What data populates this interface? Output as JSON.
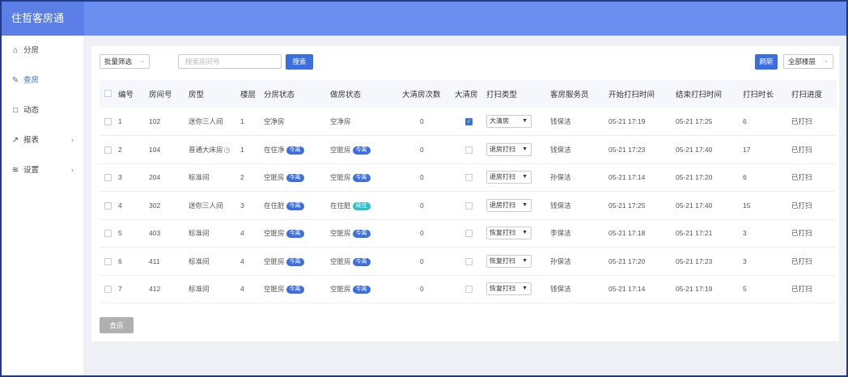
{
  "app": {
    "title": "住哲客房通"
  },
  "sidebar": {
    "items": [
      {
        "label": "分房",
        "icon": "home-icon",
        "chevron": false,
        "active": false
      },
      {
        "label": "查房",
        "icon": "edit-icon",
        "chevron": false,
        "active": true
      },
      {
        "label": "动态",
        "icon": "notification-icon",
        "chevron": false,
        "active": false
      },
      {
        "label": "报表",
        "icon": "chart-icon",
        "chevron": true,
        "active": false
      },
      {
        "label": "设置",
        "icon": "layers-icon",
        "chevron": true,
        "active": false
      }
    ]
  },
  "toolbar": {
    "batch_filter": "批量筛选",
    "search_placeholder": "搜索房间号",
    "search_label": "搜索",
    "refresh_label": "刷新",
    "floor_select": "全部楼层"
  },
  "table": {
    "headers": [
      "编号",
      "房间号",
      "房型",
      "楼层",
      "分房状态",
      "做房状态",
      "大清房次数",
      "大清房",
      "打扫类型",
      "客房服务员",
      "开始打扫时间",
      "结束打扫时间",
      "打扫时长",
      "打扫进度"
    ],
    "rows": [
      {
        "no": "1",
        "room": "102",
        "type": "迷你三人间",
        "clock": false,
        "floor": "1",
        "assign": "空净房",
        "assign_badge": "",
        "work": "空净房",
        "work_badge": "",
        "work_badge_color": "",
        "count": "0",
        "big_clean": true,
        "clean_type": "大清房",
        "staff": "钱保洁",
        "start": "05-21 17:19",
        "end": "05-21 17:25",
        "duration": "6",
        "progress": "已打扫"
      },
      {
        "no": "2",
        "room": "104",
        "type": "普通大床房",
        "clock": true,
        "floor": "1",
        "assign": "在住净",
        "assign_badge": "今离",
        "work": "空脏房",
        "work_badge": "今离",
        "work_badge_color": "blue",
        "count": "0",
        "big_clean": false,
        "clean_type": "退房打扫",
        "staff": "钱保洁",
        "start": "05-21 17:23",
        "end": "05-21 17:40",
        "duration": "17",
        "progress": "已打扫"
      },
      {
        "no": "3",
        "room": "204",
        "type": "标准间",
        "clock": false,
        "floor": "2",
        "assign": "空脏房",
        "assign_badge": "今离",
        "work": "空脏房",
        "work_badge": "今离",
        "work_badge_color": "blue",
        "count": "0",
        "big_clean": false,
        "clean_type": "退房打扫",
        "staff": "孙保洁",
        "start": "05-21 17:14",
        "end": "05-21 17:20",
        "duration": "6",
        "progress": "已打扫"
      },
      {
        "no": "4",
        "room": "302",
        "type": "迷你三人间",
        "clock": false,
        "floor": "3",
        "assign": "在住脏",
        "assign_badge": "今离",
        "work": "在住脏",
        "work_badge": "续住",
        "work_badge_color": "teal",
        "count": "0",
        "big_clean": false,
        "clean_type": "退房打扫",
        "staff": "钱保洁",
        "start": "05-21 17:25",
        "end": "05-21 17:40",
        "duration": "15",
        "progress": "已打扫"
      },
      {
        "no": "5",
        "room": "403",
        "type": "标准间",
        "clock": false,
        "floor": "4",
        "assign": "空脏房",
        "assign_badge": "今离",
        "work": "空脏房",
        "work_badge": "今离",
        "work_badge_color": "blue",
        "count": "0",
        "big_clean": false,
        "clean_type": "恢复打扫",
        "staff": "李保洁",
        "start": "05-21 17:18",
        "end": "05-21 17:21",
        "duration": "3",
        "progress": "已打扫"
      },
      {
        "no": "6",
        "room": "411",
        "type": "标准间",
        "clock": false,
        "floor": "4",
        "assign": "空脏房",
        "assign_badge": "今离",
        "work": "空脏房",
        "work_badge": "今离",
        "work_badge_color": "blue",
        "count": "0",
        "big_clean": false,
        "clean_type": "恢复打扫",
        "staff": "孙保洁",
        "start": "05-21 17:20",
        "end": "05-21 17:23",
        "duration": "3",
        "progress": "已打扫"
      },
      {
        "no": "7",
        "room": "412",
        "type": "标准间",
        "clock": false,
        "floor": "4",
        "assign": "空脏房",
        "assign_badge": "今离",
        "work": "空脏房",
        "work_badge": "今离",
        "work_badge_color": "blue",
        "count": "0",
        "big_clean": false,
        "clean_type": "恢复打扫",
        "staff": "钱保洁",
        "start": "05-21 17:14",
        "end": "05-21 17:19",
        "duration": "5",
        "progress": "已打扫"
      }
    ]
  },
  "footer": {
    "check_button": "查房"
  },
  "colors": {
    "primary": "#3b6fe0",
    "header_bg": "#6b8ff0",
    "brand_bg": "#5b7fe6",
    "teal": "#2cc0c9"
  }
}
